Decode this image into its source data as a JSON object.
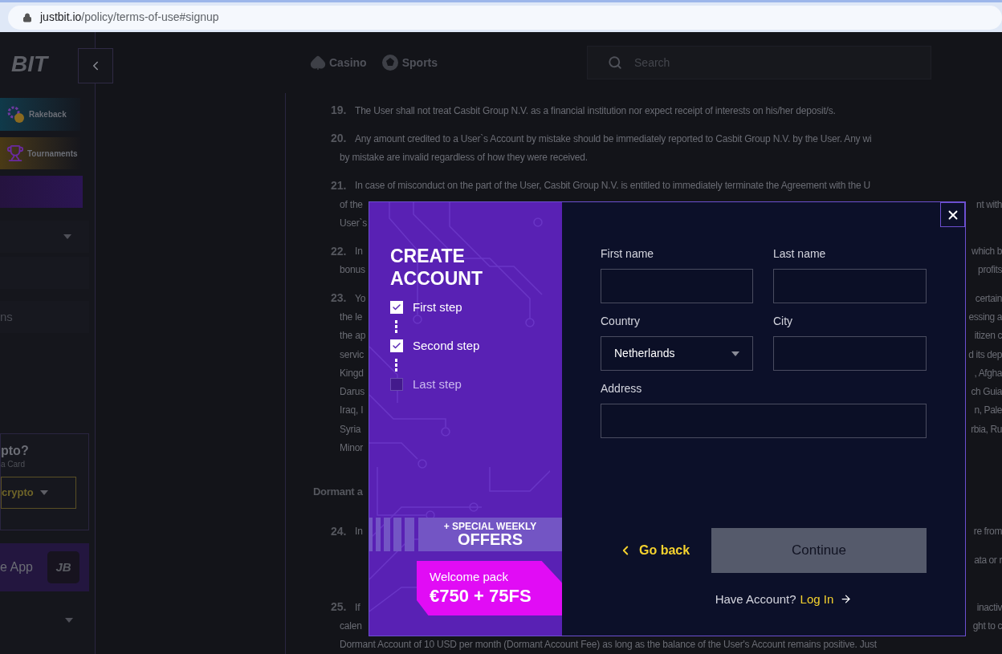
{
  "url": {
    "host": "justbit.io",
    "path": "/policy/terms-of-use#signup"
  },
  "sidebar": {
    "logo": "BIT",
    "cards": [
      {
        "kind": "rakeback",
        "label": "Rakeback"
      },
      {
        "kind": "tournaments",
        "label": "Tournaments"
      }
    ],
    "partial_item": "ns",
    "crypto_box": {
      "title": "pto?",
      "subtitle": "a Card",
      "button": "crypto"
    },
    "app_banner": {
      "label": "e App",
      "badge": "JB"
    }
  },
  "top_nav": {
    "links": [
      {
        "kind": "casino",
        "label": "Casino"
      },
      {
        "kind": "sports",
        "label": "Sports"
      }
    ],
    "search": {
      "placeholder": "Search"
    }
  },
  "terms": [
    {
      "kind": "numbered",
      "number": "19.",
      "left": "The User shall not treat Casbit Group N.V. as a financial institution nor expect receipt of interests on his/her deposit/s."
    },
    {
      "kind": "numbered",
      "number": "20.",
      "left": "Any amount credited to a User`s Account by mistake should be immediately reported to Casbit Group N.V. by the User. Any wi"
    },
    {
      "kind": "line",
      "left": "by mistake are invalid regardless of how they were received."
    },
    {
      "kind": "numbered",
      "number": "21.",
      "left": "In case of misconduct on the part of the User, Casbit Group N.V. is entitled to immediately terminate the Agreement with the U"
    },
    {
      "kind": "line",
      "left": "of the",
      "right": "nt with"
    },
    {
      "kind": "line",
      "left": "User`s"
    },
    {
      "kind": "numbered",
      "number": "22.",
      "left": "In",
      "right": "which b"
    },
    {
      "kind": "line",
      "left": "bonus",
      "right": "profits"
    },
    {
      "kind": "numbered",
      "number": "23.",
      "left": "Yo",
      "right": "certain"
    },
    {
      "kind": "line",
      "left": "the le",
      "right": "essing a"
    },
    {
      "kind": "line",
      "left": "the ap",
      "right": "itizen c"
    },
    {
      "kind": "line",
      "left": "servic",
      "right": "d its dep"
    },
    {
      "kind": "line",
      "left": "Kingd",
      "right": ", Afgha"
    },
    {
      "kind": "line",
      "left": "Darus",
      "right": "ch Guia"
    },
    {
      "kind": "line",
      "left": "Iraq, I",
      "right": "n, Pale"
    },
    {
      "kind": "line",
      "left": "Syria",
      "right": "rbia, Ru"
    },
    {
      "kind": "line",
      "left": "Minor"
    },
    {
      "kind": "heading",
      "left": "Dormant a"
    },
    {
      "kind": "numbered",
      "number": "24.",
      "left": "In",
      "right": "re from"
    },
    {
      "kind": "resumed",
      "right": "ata or r"
    },
    {
      "kind": "resumed_numbered",
      "number": "25.",
      "left": "If",
      "right": "inactiv"
    },
    {
      "kind": "line",
      "left": "calen",
      "right": "ght to c"
    },
    {
      "kind": "line",
      "left": "Dormant Account of 10 USD per month (Dormant Account Fee) as long as the balance of the User's Account remains positive. Just"
    }
  ],
  "modal": {
    "title": "CREATE ACCOUNT",
    "steps": [
      {
        "label": "First step",
        "checked": true
      },
      {
        "label": "Second step",
        "checked": true
      },
      {
        "label": "Last step",
        "checked": false
      }
    ],
    "offer": {
      "kicker": "+ SPECIAL WEEKLY",
      "title": "OFFERS"
    },
    "welcome": {
      "label": "Welcome pack",
      "amount": "€750 + 75FS"
    },
    "fields": [
      {
        "kind": "text",
        "label": "First name"
      },
      {
        "kind": "text",
        "label": "Last name"
      },
      {
        "kind": "select",
        "label": "Country",
        "value": "Netherlands"
      },
      {
        "kind": "text",
        "label": "City"
      },
      {
        "kind": "wide",
        "label": "Address"
      }
    ],
    "back_button": "Go back",
    "continue_button": "Continue",
    "login_prompt": {
      "text": "Have Account?",
      "link": "Log In"
    }
  }
}
